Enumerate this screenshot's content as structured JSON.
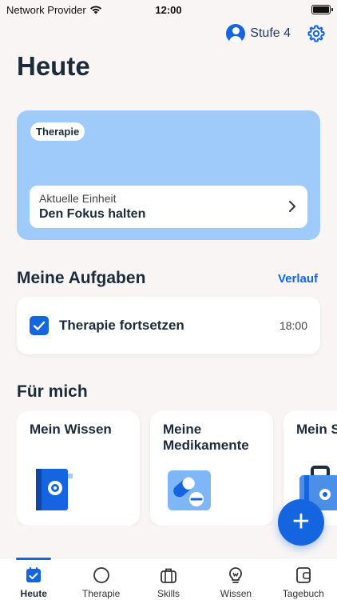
{
  "status_bar": {
    "carrier": "Network Provider",
    "time": "12:00"
  },
  "header": {
    "level_label": "Stufe 4",
    "icons": [
      "avatar-icon",
      "gear-icon"
    ],
    "title": "Heute"
  },
  "therapy_card": {
    "tag": "Therapie",
    "unit_caption": "Aktuelle Einheit",
    "unit_title": "Den Fokus halten",
    "bg_color": "#9fcbfb"
  },
  "tasks": {
    "title": "Meine Aufgaben",
    "history_link": "Verlauf",
    "items": [
      {
        "label": "Therapie fortsetzen",
        "time": "18:00",
        "checked": true
      }
    ]
  },
  "for_me": {
    "title": "Für mich",
    "tiles": [
      {
        "label": "Mein Wissen",
        "icon": "book-icon"
      },
      {
        "label": "Meine Medikamente",
        "icon": "pills-icon"
      },
      {
        "label": "Mein Skillko",
        "icon": "suitcase-icon"
      }
    ]
  },
  "fab": {
    "label": "+"
  },
  "tab_bar": {
    "items": [
      {
        "label": "Heute",
        "icon": "calendar-check-icon",
        "active": true
      },
      {
        "label": "Therapie",
        "icon": "circle-icon",
        "active": false
      },
      {
        "label": "Skills",
        "icon": "briefcase-icon",
        "active": false
      },
      {
        "label": "Wissen",
        "icon": "lightbulb-icon",
        "active": false
      },
      {
        "label": "Tagebuch",
        "icon": "journal-icon",
        "active": false
      }
    ]
  },
  "colors": {
    "accent": "#1565e0",
    "background": "#f8f5f4",
    "heading": "#1c2b3a"
  }
}
